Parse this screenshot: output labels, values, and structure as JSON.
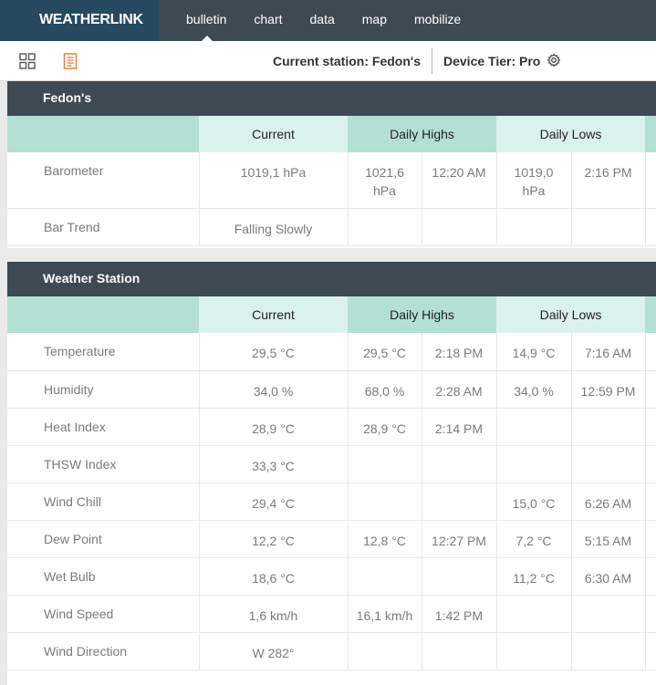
{
  "app": {
    "logo": "WEATHERLINK"
  },
  "nav": [
    {
      "label": "bulletin",
      "active": true
    },
    {
      "label": "chart"
    },
    {
      "label": "data"
    },
    {
      "label": "map"
    },
    {
      "label": "mobilize"
    }
  ],
  "toolbar": {
    "station": "Current station: Fedon's",
    "tier": "Device Tier: Pro"
  },
  "panels": [
    {
      "title": "Fedon's",
      "headers": [
        "",
        "Current",
        "Daily Highs",
        "Daily Lows"
      ],
      "rows": [
        {
          "label": "Barometer",
          "current": "1019,1 hPa",
          "hi_val": "1021,6 hPa",
          "hi_time": "12:20 AM",
          "lo_val": "1019,0 hPa",
          "lo_time": "2:16 PM"
        },
        {
          "label": "Bar Trend",
          "current": "Falling Slowly",
          "hi_val": "",
          "hi_time": "",
          "lo_val": "",
          "lo_time": ""
        }
      ]
    },
    {
      "title": "Weather Station",
      "headers": [
        "",
        "Current",
        "Daily Highs",
        "Daily Lows"
      ],
      "rows": [
        {
          "label": "Temperature",
          "current": "29,5 °C",
          "hi_val": "29,5 °C",
          "hi_time": "2:18 PM",
          "lo_val": "14,9 °C",
          "lo_time": "7:16 AM"
        },
        {
          "label": "Humidity",
          "current": "34,0 %",
          "hi_val": "68,0 %",
          "hi_time": "2:28 AM",
          "lo_val": "34,0 %",
          "lo_time": "12:59 PM"
        },
        {
          "label": "Heat Index",
          "current": "28,9 °C",
          "hi_val": "28,9 °C",
          "hi_time": "2:14 PM",
          "lo_val": "",
          "lo_time": ""
        },
        {
          "label": "THSW Index",
          "current": "33,3 °C",
          "hi_val": "",
          "hi_time": "",
          "lo_val": "",
          "lo_time": ""
        },
        {
          "label": "Wind Chill",
          "current": "29,4 °C",
          "hi_val": "",
          "hi_time": "",
          "lo_val": "15,0 °C",
          "lo_time": "6:26 AM"
        },
        {
          "label": "Dew Point",
          "current": "12,2 °C",
          "hi_val": "12,8 °C",
          "hi_time": "12:27 PM",
          "lo_val": "7,2 °C",
          "lo_time": "5:15 AM"
        },
        {
          "label": "Wet Bulb",
          "current": "18,6 °C",
          "hi_val": "",
          "hi_time": "",
          "lo_val": "11,2 °C",
          "lo_time": "6:30 AM"
        },
        {
          "label": "Wind Speed",
          "current": "1,6 km/h",
          "hi_val": "16,1 km/h",
          "hi_time": "1:42 PM",
          "lo_val": "",
          "lo_time": ""
        },
        {
          "label": "Wind Direction",
          "current": "W 282°",
          "hi_val": "",
          "hi_time": "",
          "lo_val": "",
          "lo_time": ""
        }
      ]
    }
  ],
  "icons": {
    "grid": "grid-view-icon",
    "doc": "document-view-icon",
    "gear": "gear-icon"
  },
  "colors": {
    "topbar": "#3d4a52",
    "logo_bg": "#26495f",
    "header_mint": "#b3e0d3",
    "header_light": "#daf2ec",
    "accent_orange": "#e8823a"
  }
}
